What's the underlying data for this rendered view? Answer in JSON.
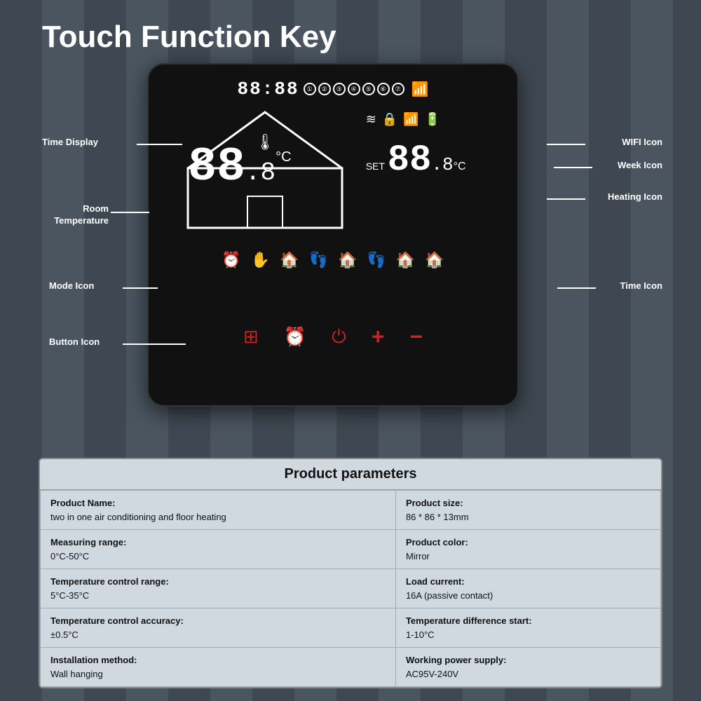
{
  "page": {
    "title": "Touch Function Key",
    "background_color": "#4a5560"
  },
  "thermostat": {
    "time_display": "88:88",
    "day_circles": [
      "①",
      "②",
      "③",
      "④",
      "⑤",
      "⑥",
      "⑦"
    ],
    "room_temp": "88",
    "room_temp_decimal": ".8",
    "room_temp_unit": "°C",
    "set_label": "SET",
    "set_temp": "88",
    "set_temp_decimal": ".8",
    "set_temp_unit": "°C",
    "status_icons": [
      "≋",
      "🔒",
      "📶",
      "🔋"
    ],
    "mode_icons": [
      "⏰",
      "✋",
      "🏠",
      "👣",
      "🏠",
      "👣",
      "🏠",
      "🏠"
    ],
    "buttons": [
      "⊞",
      "⏰",
      "⏻",
      "+",
      "−"
    ]
  },
  "labels": {
    "time_display": "Time Display",
    "room_temperature": "Room\nTemperature",
    "mode_icon": "Mode Icon",
    "button_icon": "Button Icon",
    "wifi_icon": "WIFI Icon",
    "week_icon": "Week Icon",
    "heating_icon": "Heating Icon",
    "time_icon": "Time Icon"
  },
  "product_params": {
    "title": "Product parameters",
    "rows": [
      {
        "left_label": "Product Name:",
        "left_value": "two in one air conditioning and floor heating",
        "right_label": "Product size:",
        "right_value": "86 * 86 * 13mm"
      },
      {
        "left_label": "Measuring range:",
        "left_value": "0°C-50°C",
        "right_label": "Product color:",
        "right_value": "Mirror"
      },
      {
        "left_label": "Temperature control range:",
        "left_value": "5°C-35°C",
        "right_label": "Load current:",
        "right_value": "16A (passive contact)"
      },
      {
        "left_label": "Temperature control accuracy:",
        "left_value": "±0.5°C",
        "right_label": "Temperature difference start:",
        "right_value": "1-10°C"
      },
      {
        "left_label": "Installation method:",
        "left_value": "Wall hanging",
        "right_label": "Working power supply:",
        "right_value": "AC95V-240V"
      }
    ]
  }
}
